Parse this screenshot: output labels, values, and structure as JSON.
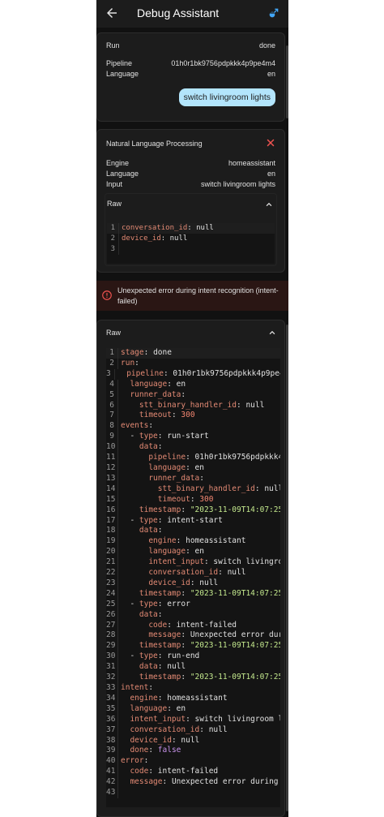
{
  "appbar": {
    "title": "Debug Assistant"
  },
  "run_card": {
    "label": "Run",
    "status": "done",
    "pipeline_label": "Pipeline",
    "pipeline_value": "01h0r1bk9756pdpkkk4p9pe4m4",
    "language_label": "Language",
    "language_value": "en",
    "bubble": "switch livingroom lights"
  },
  "nlp_card": {
    "title": "Natural Language Processing",
    "engine_label": "Engine",
    "engine_value": "homeassistant",
    "language_label": "Language",
    "language_value": "en",
    "input_label": "Input",
    "input_value": "switch livingroom lights",
    "raw_label": "Raw",
    "code": [
      {
        "n": "1",
        "k": "conversation_id",
        "v": " null"
      },
      {
        "n": "2",
        "k": "device_id",
        "v": " null"
      },
      {
        "n": "3",
        "k": "",
        "v": ""
      }
    ]
  },
  "alert": {
    "message": "Unexpected error during intent recognition (intent-failed)"
  },
  "raw_card": {
    "label": "Raw",
    "lines": [
      {
        "n": "1",
        "i": "",
        "k": "stage",
        "v": " done",
        "t": "v"
      },
      {
        "n": "2",
        "i": "",
        "k": "run",
        "v": "",
        "t": "v"
      },
      {
        "n": "3",
        "i": "  ",
        "k": "pipeline",
        "v": " 01h0r1bk9756pdpkkk4p9pe4",
        "t": "v"
      },
      {
        "n": "4",
        "i": "  ",
        "k": "language",
        "v": " en",
        "t": "v"
      },
      {
        "n": "5",
        "i": "  ",
        "k": "runner_data",
        "v": "",
        "t": "v"
      },
      {
        "n": "6",
        "i": "    ",
        "k": "stt_binary_handler_id",
        "v": " null",
        "t": "v"
      },
      {
        "n": "7",
        "i": "    ",
        "k": "timeout",
        "v": " 300",
        "t": "n"
      },
      {
        "n": "8",
        "i": "",
        "k": "events",
        "v": "",
        "t": "v"
      },
      {
        "n": "9",
        "i": "  - ",
        "k": "type",
        "v": " run-start",
        "t": "v"
      },
      {
        "n": "10",
        "i": "    ",
        "k": "data",
        "v": "",
        "t": "v"
      },
      {
        "n": "11",
        "i": "      ",
        "k": "pipeline",
        "v": " 01h0r1bk9756pdpkkk4p",
        "t": "v"
      },
      {
        "n": "12",
        "i": "      ",
        "k": "language",
        "v": " en",
        "t": "v"
      },
      {
        "n": "13",
        "i": "      ",
        "k": "runner_data",
        "v": "",
        "t": "v"
      },
      {
        "n": "14",
        "i": "        ",
        "k": "stt_binary_handler_id",
        "v": " null",
        "t": "v"
      },
      {
        "n": "15",
        "i": "        ",
        "k": "timeout",
        "v": " 300",
        "t": "n"
      },
      {
        "n": "16",
        "i": "    ",
        "k": "timestamp",
        "v": " \"2023-11-09T14:07:25",
        "t": "s"
      },
      {
        "n": "17",
        "i": "  - ",
        "k": "type",
        "v": " intent-start",
        "t": "v"
      },
      {
        "n": "18",
        "i": "    ",
        "k": "data",
        "v": "",
        "t": "v"
      },
      {
        "n": "19",
        "i": "      ",
        "k": "engine",
        "v": " homeassistant",
        "t": "v"
      },
      {
        "n": "20",
        "i": "      ",
        "k": "language",
        "v": " en",
        "t": "v"
      },
      {
        "n": "21",
        "i": "      ",
        "k": "intent_input",
        "v": " switch livingroo",
        "t": "v"
      },
      {
        "n": "22",
        "i": "      ",
        "k": "conversation_id",
        "v": " null",
        "t": "v"
      },
      {
        "n": "23",
        "i": "      ",
        "k": "device_id",
        "v": " null",
        "t": "v"
      },
      {
        "n": "24",
        "i": "    ",
        "k": "timestamp",
        "v": " \"2023-11-09T14:07:25",
        "t": "s"
      },
      {
        "n": "25",
        "i": "  - ",
        "k": "type",
        "v": " error",
        "t": "v"
      },
      {
        "n": "26",
        "i": "    ",
        "k": "data",
        "v": "",
        "t": "v"
      },
      {
        "n": "27",
        "i": "      ",
        "k": "code",
        "v": " intent-failed",
        "t": "v"
      },
      {
        "n": "28",
        "i": "      ",
        "k": "message",
        "v": " Unexpected error dur",
        "t": "v"
      },
      {
        "n": "29",
        "i": "    ",
        "k": "timestamp",
        "v": " \"2023-11-09T14:07:25",
        "t": "s"
      },
      {
        "n": "30",
        "i": "  - ",
        "k": "type",
        "v": " run-end",
        "t": "v"
      },
      {
        "n": "31",
        "i": "    ",
        "k": "data",
        "v": " null",
        "t": "v"
      },
      {
        "n": "32",
        "i": "    ",
        "k": "timestamp",
        "v": " \"2023-11-09T14:07:25",
        "t": "s"
      },
      {
        "n": "33",
        "i": "",
        "k": "intent",
        "v": "",
        "t": "v"
      },
      {
        "n": "34",
        "i": "  ",
        "k": "engine",
        "v": " homeassistant",
        "t": "v"
      },
      {
        "n": "35",
        "i": "  ",
        "k": "language",
        "v": " en",
        "t": "v"
      },
      {
        "n": "36",
        "i": "  ",
        "k": "intent_input",
        "v": " switch livingroom l",
        "t": "v"
      },
      {
        "n": "37",
        "i": "  ",
        "k": "conversation_id",
        "v": " null",
        "t": "v"
      },
      {
        "n": "38",
        "i": "  ",
        "k": "device_id",
        "v": " null",
        "t": "v"
      },
      {
        "n": "39",
        "i": "  ",
        "k": "done",
        "v": " false",
        "t": "b"
      },
      {
        "n": "40",
        "i": "",
        "k": "error",
        "v": "",
        "t": "v"
      },
      {
        "n": "41",
        "i": "  ",
        "k": "code",
        "v": " intent-failed",
        "t": "v"
      },
      {
        "n": "42",
        "i": "  ",
        "k": "message",
        "v": " Unexpected error during",
        "t": "v"
      },
      {
        "n": "43",
        "i": "",
        "k": "",
        "v": "",
        "t": "v"
      }
    ]
  },
  "colors": {
    "bubble": "#b3e5fc",
    "error_red": "#ef5350",
    "accent_blue": "#42a5f5",
    "key": "#e38a74",
    "string": "#c3e88d",
    "number": "#f48771",
    "boolean": "#c792ea"
  },
  "icons": {
    "back": "arrow-left-icon",
    "bug": "bug-icon",
    "close": "close-icon",
    "chevron": "chevron-up-icon",
    "alert": "alert-circle-icon"
  }
}
